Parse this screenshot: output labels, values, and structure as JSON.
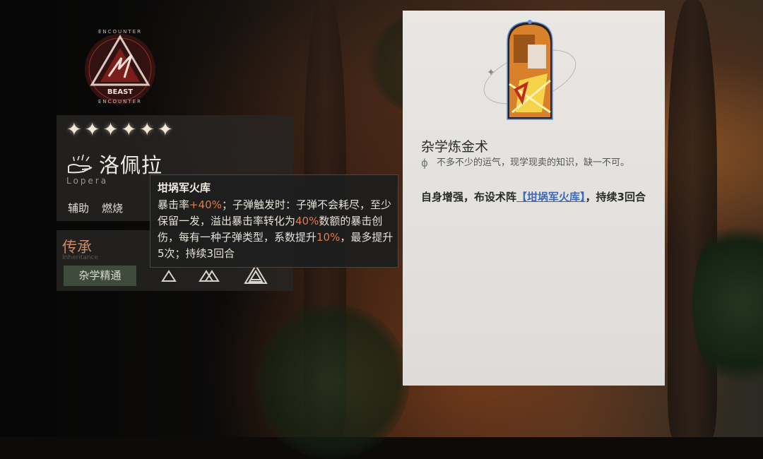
{
  "emblem": {
    "top_text": "ENCOUNTER",
    "label": "BEAST",
    "bottom_text": "ENCOUNTER"
  },
  "character": {
    "stars": 6,
    "name": "洛佩拉",
    "name_en": "Lopera",
    "tags": [
      "辅助",
      "燃烧"
    ]
  },
  "inheritance": {
    "title": "传承",
    "subtitle": "Inheritance",
    "chip": "杂学精通",
    "icons": [
      "triangle-icon",
      "double-triangle-icon",
      "triple-triangle-icon"
    ]
  },
  "tooltip": {
    "title": "坩埚军火库",
    "parts": [
      {
        "text": "暴击率",
        "hl": false
      },
      {
        "text": "+40%",
        "hl": true
      },
      {
        "text": "；子弹触发时：子弹不会耗尽，至少保留一发，溢出暴击率转化为",
        "hl": false
      },
      {
        "text": "40%",
        "hl": true
      },
      {
        "text": "数额的暴击创伤，每有一种子弹类型，系数提升",
        "hl": false
      },
      {
        "text": "10%",
        "hl": true
      },
      {
        "text": "，最多提升5次；持续3回合",
        "hl": false
      }
    ]
  },
  "card": {
    "title": "杂学炼金术",
    "phi": "ϕ",
    "flavor": "不多不少的运气，现学现卖的知识，缺一不可。",
    "effect_pre": "自身增强，布设术阵",
    "effect_link": "【坩埚军火库】",
    "effect_post": "，持续3回合"
  },
  "colors": {
    "highlight": "#e0794a",
    "link": "#3d68b8",
    "inherit_title": "#c98a6a"
  }
}
